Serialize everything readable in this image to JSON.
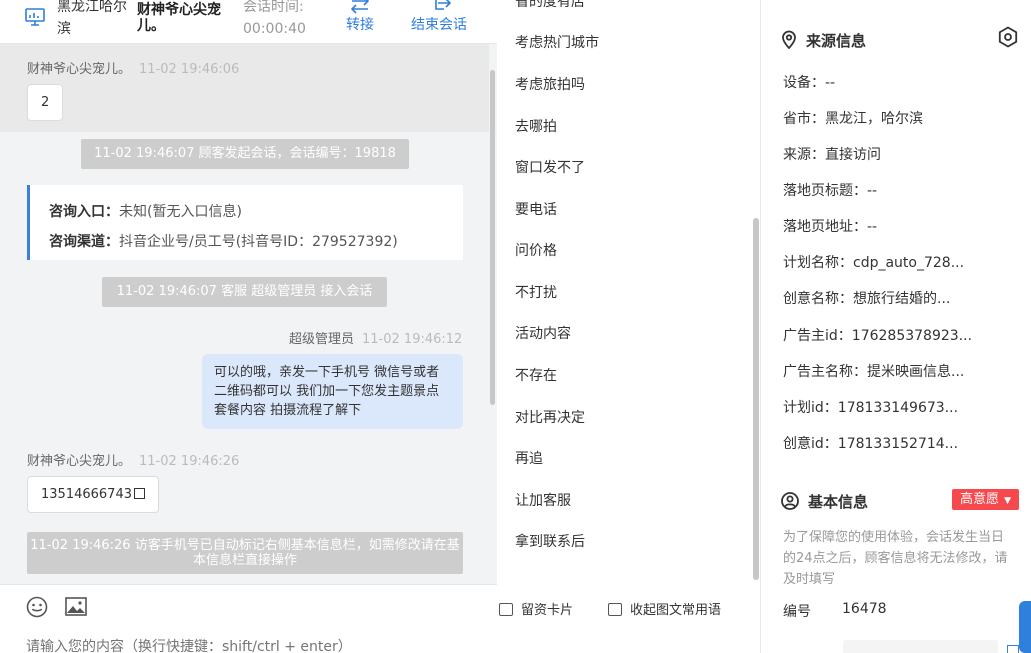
{
  "header": {
    "location": "黑龙江哈尔滨",
    "visitor_name": "财神爷心尖宠儿。",
    "time_label": "会话时间:",
    "time_value": "00:00:40",
    "transfer_label": "转接",
    "end_label": "结束会话"
  },
  "messages": {
    "visitor1": {
      "sender": "财神爷心尖宠儿。",
      "time": "11-02 19:46:06",
      "text": "2"
    },
    "sys1": "11-02 19:46:07 顾客发起会话，会话编号：19818",
    "info_card": {
      "entry_label": "咨询入口：",
      "entry_value": "未知(暂无入口信息)",
      "channel_label": "咨询渠道：",
      "channel_value": "抖音企业号/员工号(抖音号ID：279527392)"
    },
    "sys2": "11-02 19:46:07 客服 超级管理员 接入会话",
    "agent1": {
      "sender": "超级管理员",
      "time": "11-02 19:46:12",
      "text": "可以的哦，亲发一下手机号 微信号或者二维码都可以 我们加一下您发主题景点 套餐内容 拍摄流程了解下"
    },
    "visitor2": {
      "sender": "财神爷心尖宠儿。",
      "time": "11-02 19:46:26",
      "text": "13514666743"
    },
    "sys3": "11-02 19:46:26 访客手机号已自动标记右侧基本信息栏，如需修改请在基本信息栏直接操作"
  },
  "bottom": {
    "message_card_label": "留资卡片",
    "collapse_label": "收起图文常用语",
    "input_placeholder": "请输入您的内容（换行快捷键：shift/ctrl + enter）"
  },
  "quick_replies": [
    "省的度有店",
    "考虑热门城市",
    "考虑旅拍吗",
    "去哪拍",
    "窗口发不了",
    "要电话",
    "问价格",
    "不打扰",
    "活动内容",
    "不存在",
    "对比再决定",
    "再追",
    "让加客服",
    "拿到联系后"
  ],
  "source": {
    "title": "来源信息",
    "fields": [
      {
        "label": "设备：",
        "value": "--"
      },
      {
        "label": "省市：",
        "value": "黑龙江，哈尔滨"
      },
      {
        "label": "来源：",
        "value": "直接访问"
      },
      {
        "label": "落地页标题：",
        "value": "--"
      },
      {
        "label": "落地页地址：",
        "value": "--"
      },
      {
        "label": "计划名称：",
        "value": "cdp_auto_728..."
      },
      {
        "label": "创意名称：",
        "value": "想旅行结婚的..."
      },
      {
        "label": "广告主id：",
        "value": "176285378923..."
      },
      {
        "label": "广告主名称：",
        "value": "提米映画信息..."
      },
      {
        "label": "计划id：",
        "value": "178133149673..."
      },
      {
        "label": "创意id：",
        "value": "178133152714..."
      }
    ]
  },
  "basic": {
    "title": "基本信息",
    "intent_label": "高意愿",
    "notice": "为了保障您的使用体验，会话发生当日的24点之后，顾客信息将无法修改，请及时填写",
    "id_label": "编号",
    "id_value": "16478"
  },
  "colors": {
    "accent": "#2f7fdc",
    "intent": "#f5494e",
    "agent_bubble": "#dbe8fb",
    "system_msg": "#cdcdcd"
  }
}
